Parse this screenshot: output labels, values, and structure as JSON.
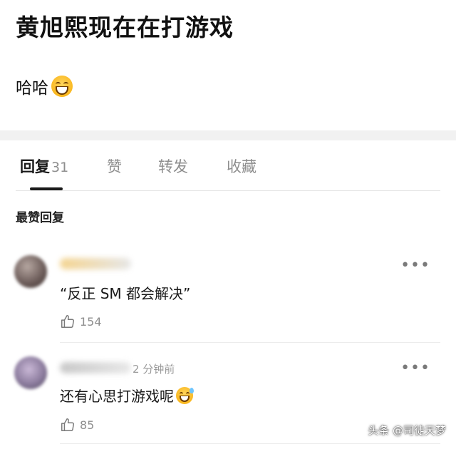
{
  "post": {
    "title": "黄旭熙现在在打游戏",
    "body": "哈哈",
    "body_emoji": "grinning-face-icon"
  },
  "tabs": [
    {
      "label": "回复",
      "count": "31",
      "active": true
    },
    {
      "label": "赞",
      "active": false
    },
    {
      "label": "转发",
      "active": false
    },
    {
      "label": "收藏",
      "active": false
    }
  ],
  "section_label": "最赞回复",
  "comments": [
    {
      "nickname_visible": false,
      "time": "",
      "text": "“反正 SM 都会解决”",
      "likes": "154"
    },
    {
      "nickname_visible": false,
      "time": "2 分钟前",
      "text": "还有心思打游戏呢",
      "text_emoji": "grinning-sweat-icon",
      "likes": "85"
    }
  ],
  "more_glyph": "•••",
  "watermark": "头条 @司徒天梦",
  "colors": {
    "primary_text": "#1a1a1a",
    "secondary_text": "#8e8e8e",
    "band": "#f1f1f1"
  }
}
